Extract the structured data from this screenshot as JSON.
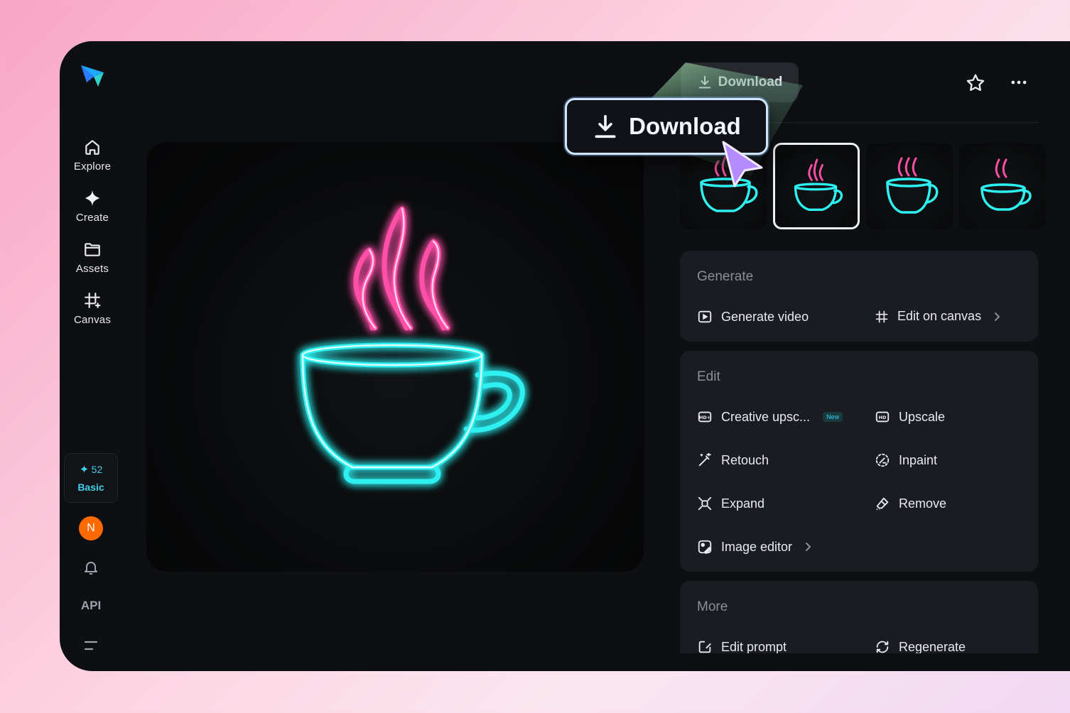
{
  "nav": {
    "items": [
      {
        "label": "Explore",
        "icon": "home-icon"
      },
      {
        "label": "Create",
        "icon": "sparkle-icon"
      },
      {
        "label": "Assets",
        "icon": "folder-icon"
      },
      {
        "label": "Canvas",
        "icon": "canvas-icon"
      }
    ],
    "credits": {
      "count": "52",
      "plan": "Basic"
    },
    "avatar_initial": "N",
    "api_label": "API"
  },
  "topbar": {
    "download_label": "Download",
    "download_callout_label": "Download"
  },
  "cards": {
    "generate": {
      "title": "Generate",
      "actions": [
        {
          "label": "Generate video",
          "icon": "play-square-icon"
        },
        {
          "label": "Edit on canvas",
          "icon": "canvas-icon"
        }
      ]
    },
    "edit": {
      "title": "Edit",
      "actions": [
        {
          "label": "Creative upsc...",
          "icon": "hd-plus-icon",
          "badge": "New"
        },
        {
          "label": "Upscale",
          "icon": "hd-icon"
        },
        {
          "label": "Retouch",
          "icon": "magic-wand-icon"
        },
        {
          "label": "Inpaint",
          "icon": "inpaint-icon"
        },
        {
          "label": "Expand",
          "icon": "expand-icon"
        },
        {
          "label": "Remove",
          "icon": "eraser-icon"
        },
        {
          "label": "Image editor",
          "icon": "image-edit-icon"
        }
      ]
    },
    "more": {
      "title": "More",
      "actions": [
        {
          "label": "Edit prompt",
          "icon": "edit-prompt-icon"
        },
        {
          "label": "Regenerate",
          "icon": "regenerate-icon"
        }
      ]
    }
  },
  "colors": {
    "accent_cyan": "#3fd1ec",
    "neon_pink": "#ff4fa8",
    "neon_cyan": "#2ef0f0",
    "avatar": "#ff6a00",
    "cursor": "#b58cff"
  }
}
